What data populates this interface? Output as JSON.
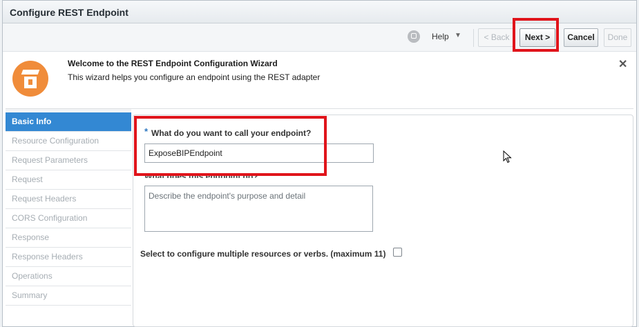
{
  "dialog": {
    "title": "Configure REST Endpoint"
  },
  "toolbar": {
    "help_label": "Help",
    "back_label": "< Back",
    "next_label": "Next >",
    "cancel_label": "Cancel",
    "done_label": "Done"
  },
  "welcome": {
    "title": "Welcome to the REST Endpoint Configuration Wizard",
    "description": "This wizard helps you configure an endpoint using the REST adapter"
  },
  "nav": {
    "items": [
      {
        "label": "Basic Info",
        "active": true
      },
      {
        "label": "Resource Configuration",
        "active": false
      },
      {
        "label": "Request Parameters",
        "active": false
      },
      {
        "label": "Request",
        "active": false
      },
      {
        "label": "Request Headers",
        "active": false
      },
      {
        "label": "CORS Configuration",
        "active": false
      },
      {
        "label": "Response",
        "active": false
      },
      {
        "label": "Response Headers",
        "active": false
      },
      {
        "label": "Operations",
        "active": false
      },
      {
        "label": "Summary",
        "active": false
      }
    ]
  },
  "form": {
    "required_marker": "*",
    "name_label": "What do you want to call your endpoint?",
    "name_value": "ExposeBIPEndpoint",
    "description_label": "What does this endpoint do?",
    "description_placeholder": "Describe the endpoint's purpose and detail",
    "multi_label": "Select to configure multiple resources or verbs. (maximum 11)",
    "multi_checked": false
  },
  "colors": {
    "highlight": "#e0141b",
    "nav_active": "#3388d3",
    "wizard_icon": "#f08c3a"
  }
}
